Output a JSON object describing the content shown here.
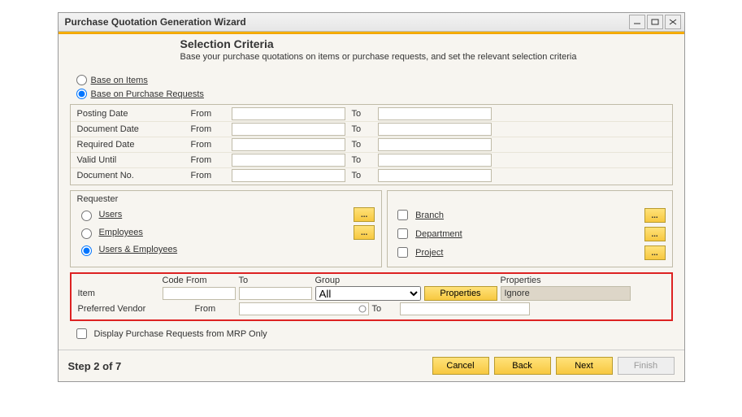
{
  "window": {
    "title": "Purchase Quotation Generation Wizard"
  },
  "header": {
    "title": "Selection Criteria",
    "subtitle": "Base your purchase quotations on items or purchase requests, and set the relevant selection criteria"
  },
  "base_on": {
    "items": "Base on Items",
    "requests": "Base on Purchase Requests"
  },
  "date_grid": {
    "rows": [
      {
        "label": "Posting Date",
        "from": "From",
        "to": "To"
      },
      {
        "label": "Document Date",
        "from": "From",
        "to": "To"
      },
      {
        "label": "Required Date",
        "from": "From",
        "to": "To"
      },
      {
        "label": "Valid Until",
        "from": "From",
        "to": "To"
      },
      {
        "label": "Document No.",
        "from": "From",
        "to": "To"
      }
    ]
  },
  "requester_panel": {
    "title": "Requester",
    "users": "Users",
    "employees": "Employees",
    "both": "Users & Employees"
  },
  "dim_panel": {
    "branch": "Branch",
    "department": "Department",
    "project": "Project"
  },
  "item_panel": {
    "hdr_code_from": "Code From",
    "hdr_to": "To",
    "hdr_group": "Group",
    "hdr_properties": "Properties",
    "item_label": "Item",
    "group_value": "All",
    "props_btn": "Properties",
    "props_status": "Ignore",
    "vendor_label": "Preferred Vendor",
    "vendor_from": "From",
    "vendor_to": "To"
  },
  "mrp": {
    "label": "Display Purchase Requests from MRP Only"
  },
  "footer": {
    "step": "Step 2 of 7",
    "cancel": "Cancel",
    "back": "Back",
    "next": "Next",
    "finish": "Finish"
  }
}
